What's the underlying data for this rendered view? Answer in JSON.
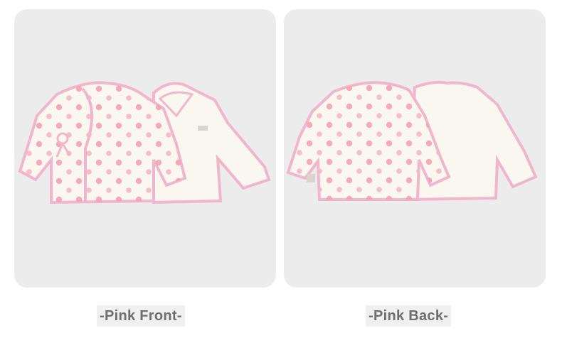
{
  "panels": [
    {
      "id": "front",
      "caption": "-Pink Front-"
    },
    {
      "id": "back",
      "caption": "-Pink Back-"
    }
  ],
  "colors": {
    "panel_bg": "#ececec",
    "garment": "#faf7f1",
    "trim": "#f0b7cc",
    "dots": "#f4a0b4",
    "caption_text": "#6e6e6e"
  }
}
